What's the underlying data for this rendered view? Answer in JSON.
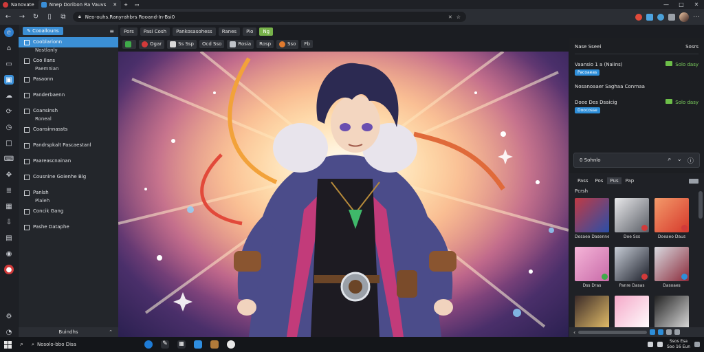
{
  "titlebar": {
    "tabs": [
      {
        "label": "Nanovate"
      },
      {
        "label": "Nnep Doribon Ra Vauvs"
      }
    ],
    "new_tab_label": "+",
    "extra_tab_icon": "window-icon"
  },
  "addressbar": {
    "url": "Neo-ouhs.Ranyrahbrs Rooand-In-Bsi0",
    "clear_glyph": "✕",
    "bookmark_glyph": "☆"
  },
  "rail": {
    "icons": [
      "edge-icon",
      "home-icon",
      "inbox-icon",
      "active-panel-icon",
      "cloud-icon",
      "refresh-icon",
      "history-icon",
      "square-icon",
      "keyboard-icon",
      "puzzle-icon",
      "layers-icon",
      "table-icon",
      "download-icon",
      "grid-icon",
      "camera-icon",
      "clock-icon",
      "record-icon",
      "settings-icon",
      "bell-icon"
    ]
  },
  "sidebar": {
    "header_label": "Cooallouns",
    "header_action": "≡",
    "items": [
      {
        "label": "Cooblarionn",
        "sub": "Nostlanly"
      },
      {
        "label": "Coo Ilans",
        "sub": "Paemnian"
      },
      {
        "label": "Pasaonn",
        "sub": ""
      },
      {
        "label": "Panderbaenn",
        "sub": ""
      },
      {
        "label": "Coansinsh",
        "sub": "Roneal"
      },
      {
        "label": "Coansinnassts",
        "sub": ""
      },
      {
        "label": "Pandrspkalt Pascaestanl",
        "sub": ""
      },
      {
        "label": "Paareascnainan",
        "sub": ""
      },
      {
        "label": "Cousnine Goienhe Blg",
        "sub": ""
      },
      {
        "label": "Panlsh",
        "sub": "Plaleh"
      },
      {
        "label": "Concik Gang",
        "sub": ""
      },
      {
        "label": "Pashe Dataphe",
        "sub": ""
      }
    ],
    "footer": "Buindhs"
  },
  "toolbar1": {
    "items": [
      "Pors",
      "Pasi Cosh",
      "Pankosasohess",
      "Ranes",
      "Pio",
      "Ng"
    ]
  },
  "toolbar2": {
    "items": [
      {
        "label": "",
        "icon": "green-check-icon",
        "color": "#3faa4a"
      },
      {
        "label": "Ogar",
        "icon": "red-record-icon",
        "color": "#d23a3a"
      },
      {
        "label": "Ss Ssp",
        "icon": "shield-icon",
        "color": "#d9d9d9"
      },
      {
        "label": "Ocd Sso",
        "icon": "",
        "color": ""
      },
      {
        "label": "Rosia",
        "icon": "bars-icon",
        "color": "#bfc3c9"
      },
      {
        "label": "Rosp",
        "icon": "",
        "color": ""
      },
      {
        "label": "Sso",
        "icon": "circle-icon",
        "color": "#e07a2e"
      },
      {
        "label": "Fb",
        "icon": "",
        "color": ""
      }
    ]
  },
  "rightpanel": {
    "header_left": "Nase Sseei",
    "header_right": "Sosrs",
    "sections": [
      {
        "title": "Vaansio 1 a (Naiins)",
        "status": "Solo dasy",
        "tag": "Pacoaeas"
      },
      {
        "title": "Nosanoaaer Saghaa Conrnaa",
        "status": "",
        "tag": ""
      },
      {
        "title": "Doee Des Dsaicig",
        "status": "Solo dasy",
        "tag": "Doocosse"
      }
    ],
    "search_value": "0 Sohnlo",
    "search_icons": [
      "search-icon",
      "chevron-down-icon",
      "info-icon"
    ],
    "tabs": [
      "Pass",
      "Pos",
      "Pus",
      "Pap"
    ],
    "section_label": "Pcrsh",
    "thumbs": [
      {
        "caption": "Dosaeo Dasenne",
        "c1": "#c03a44",
        "c2": "#2a4fa8",
        "badge": ""
      },
      {
        "caption": "Doe Sss",
        "c1": "#e8e8ea",
        "c2": "#5a5e66",
        "badge": "#d23a3a"
      },
      {
        "caption": "Doeaeo Daus",
        "c1": "#f39a6a",
        "c2": "#d6382b",
        "badge": "#d23a3a"
      },
      {
        "caption": "Dss Dras",
        "c1": "#f5b5d8",
        "c2": "#c86aa8",
        "badge": "#3faa4a"
      },
      {
        "caption": "Panre Dasas",
        "c1": "#c7cdd6",
        "c2": "#1c1f2a",
        "badge": "#d23a3a"
      },
      {
        "caption": "Dasoaes",
        "c1": "#d8dae0",
        "c2": "#8b2a3a",
        "badge": "#2d8ed9"
      },
      {
        "caption": "",
        "c1": "#3a2a28",
        "c2": "#e7c16a",
        "badge": ""
      },
      {
        "caption": "",
        "c1": "#f5a8c8",
        "c2": "#ffffff",
        "badge": ""
      },
      {
        "caption": "",
        "c1": "#222",
        "c2": "#dedede",
        "badge": ""
      }
    ]
  },
  "taskbar": {
    "search_text": "Nosolo-bbo Disa",
    "clock_time": "Ssos Esa",
    "clock_date": "Soo 16 Eun"
  }
}
